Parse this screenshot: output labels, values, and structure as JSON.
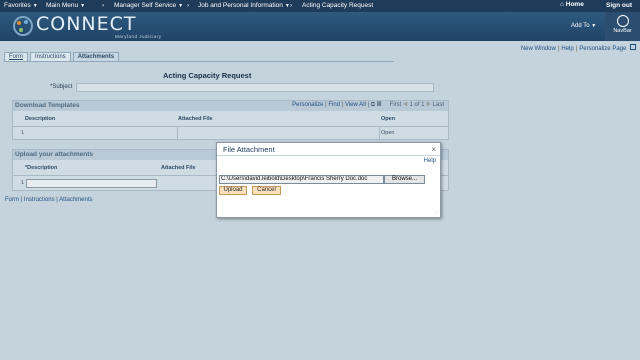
{
  "topnav": {
    "favorites": "Favorites",
    "main_menu": "Main Menu",
    "manager": "Manager Self Service",
    "job": "Job and Personal Information",
    "acting": "Acting Capacity Request",
    "home": "Home",
    "signout": "Sign out"
  },
  "banner": {
    "logo": "CONNECT",
    "sub": "Maryland Judiciary",
    "addto": "Add To",
    "navbar": "NavBar"
  },
  "toolbar": {
    "new_window": "New Window",
    "help": "Help",
    "personalize": "Personalize Page"
  },
  "tabs": [
    "Form",
    "Instructions",
    "Attachments"
  ],
  "page": {
    "title": "Acting Capacity Request",
    "subject_label": "*Subject",
    "subject_value": ""
  },
  "download": {
    "title": "Download Templates",
    "personalize": "Personalize",
    "find": "Find",
    "viewall": "View All",
    "first": "First",
    "count": "1 of 1",
    "last": "Last",
    "col_desc": "Description",
    "col_file": "Attached File",
    "col_open": "Open",
    "row_num": "1",
    "row_open": "Open"
  },
  "upload": {
    "title": "Upload your attachments",
    "col_desc": "*Description",
    "col_file": "Attached File",
    "row_num": "1"
  },
  "footer": {
    "form": "Form",
    "instructions": "Instructions",
    "attachments": "Attachments"
  },
  "modal": {
    "title": "File Attachment",
    "help": "Help",
    "path": "C:\\Users\\david.leibold\\Desktop\\Francis Sherry Doc.doc",
    "browse": "Browse...",
    "upload": "Upload",
    "cancel": "Cancel"
  }
}
